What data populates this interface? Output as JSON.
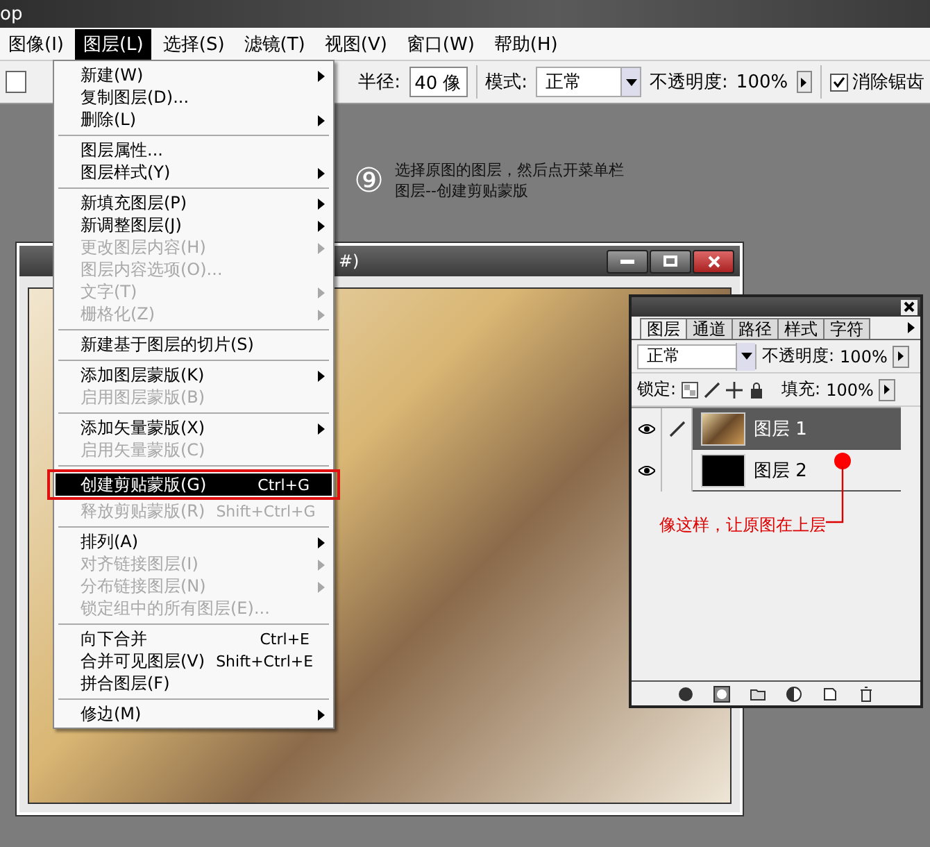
{
  "app_title": "op",
  "menubar": [
    {
      "label": "图像(I)",
      "selected": false
    },
    {
      "label": "图层(L)",
      "selected": true
    },
    {
      "label": "选择(S)",
      "selected": false
    },
    {
      "label": "滤镜(T)",
      "selected": false
    },
    {
      "label": "视图(V)",
      "selected": false
    },
    {
      "label": "窗口(W)",
      "selected": false
    },
    {
      "label": "帮助(H)",
      "selected": false
    }
  ],
  "options": {
    "radius_label": "半径:",
    "radius_value": "40 像",
    "mode_label": "模式:",
    "mode_value": "正常",
    "opacity_label": "不透明度:",
    "opacity_value": "100%",
    "antialias_label": "消除锯齿",
    "antialias_checked": true
  },
  "menu": [
    [
      {
        "label": "新建(W)",
        "submenu": true,
        "disabled": false,
        "selected": false
      },
      {
        "label": "复制图层(D)...",
        "submenu": false,
        "disabled": false,
        "selected": false
      },
      {
        "label": "删除(L)",
        "submenu": true,
        "disabled": false,
        "selected": false
      }
    ],
    [
      {
        "label": "图层属性...",
        "submenu": false,
        "disabled": false,
        "selected": false
      },
      {
        "label": "图层样式(Y)",
        "submenu": true,
        "disabled": false,
        "selected": false
      }
    ],
    [
      {
        "label": "新填充图层(P)",
        "submenu": true,
        "disabled": false,
        "selected": false
      },
      {
        "label": "新调整图层(J)",
        "submenu": true,
        "disabled": false,
        "selected": false
      },
      {
        "label": "更改图层内容(H)",
        "submenu": true,
        "disabled": true,
        "selected": false
      },
      {
        "label": "图层内容选项(O)...",
        "submenu": false,
        "disabled": true,
        "selected": false
      },
      {
        "label": "文字(T)",
        "submenu": true,
        "disabled": true,
        "selected": false
      },
      {
        "label": "栅格化(Z)",
        "submenu": true,
        "disabled": true,
        "selected": false
      }
    ],
    [
      {
        "label": "新建基于图层的切片(S)",
        "submenu": false,
        "disabled": false,
        "selected": false
      }
    ],
    [
      {
        "label": "添加图层蒙版(K)",
        "submenu": true,
        "disabled": false,
        "selected": false
      },
      {
        "label": "启用图层蒙版(B)",
        "submenu": false,
        "disabled": true,
        "selected": false
      }
    ],
    [
      {
        "label": "添加矢量蒙版(X)",
        "submenu": true,
        "disabled": false,
        "selected": false
      },
      {
        "label": "启用矢量蒙版(C)",
        "submenu": false,
        "disabled": true,
        "selected": false
      }
    ],
    [
      {
        "label": "创建剪贴蒙版(G)",
        "shortcut": "Ctrl+G",
        "submenu": false,
        "disabled": false,
        "selected": true
      },
      {
        "label": "释放剪贴蒙版(R)",
        "shortcut": "Shift+Ctrl+G",
        "submenu": false,
        "disabled": true,
        "selected": false
      }
    ],
    [
      {
        "label": "排列(A)",
        "submenu": true,
        "disabled": false,
        "selected": false
      },
      {
        "label": "对齐链接图层(I)",
        "submenu": true,
        "disabled": true,
        "selected": false
      },
      {
        "label": "分布链接图层(N)",
        "submenu": true,
        "disabled": true,
        "selected": false
      },
      {
        "label": "锁定组中的所有图层(E)...",
        "submenu": false,
        "disabled": true,
        "selected": false
      }
    ],
    [
      {
        "label": "向下合并",
        "shortcut": "Ctrl+E",
        "submenu": false,
        "disabled": false,
        "selected": false
      },
      {
        "label": "合并可见图层(V)",
        "shortcut": "Shift+Ctrl+E",
        "submenu": false,
        "disabled": false,
        "selected": false
      },
      {
        "label": "拼合图层(F)",
        "submenu": false,
        "disabled": false,
        "selected": false
      }
    ],
    [
      {
        "label": "修边(M)",
        "submenu": true,
        "disabled": false,
        "selected": false
      }
    ]
  ],
  "note": {
    "step": "⑨",
    "lines": [
      "选择原图的图层，然后点开菜单栏",
      "图层--创建剪贴蒙版"
    ]
  },
  "document": {
    "title": "#)"
  },
  "layers_panel": {
    "tabs": [
      {
        "label": "图层",
        "selected": true
      },
      {
        "label": "通道",
        "selected": false
      },
      {
        "label": "路径",
        "selected": false
      },
      {
        "label": "样式",
        "selected": false
      },
      {
        "label": "字符",
        "selected": false
      }
    ],
    "blend_mode": "正常",
    "opacity_label": "不透明度:",
    "opacity_value": "100%",
    "lock_label": "锁定:",
    "fill_label": "填充:",
    "fill_value": "100%",
    "layers": [
      {
        "name": "图层 1",
        "selected": true,
        "visible": true,
        "brush": true,
        "kind": "photo"
      },
      {
        "name": "图层 2",
        "selected": false,
        "visible": true,
        "brush": false,
        "kind": "fill"
      }
    ],
    "annotation": "像这样，让原图在上层"
  }
}
